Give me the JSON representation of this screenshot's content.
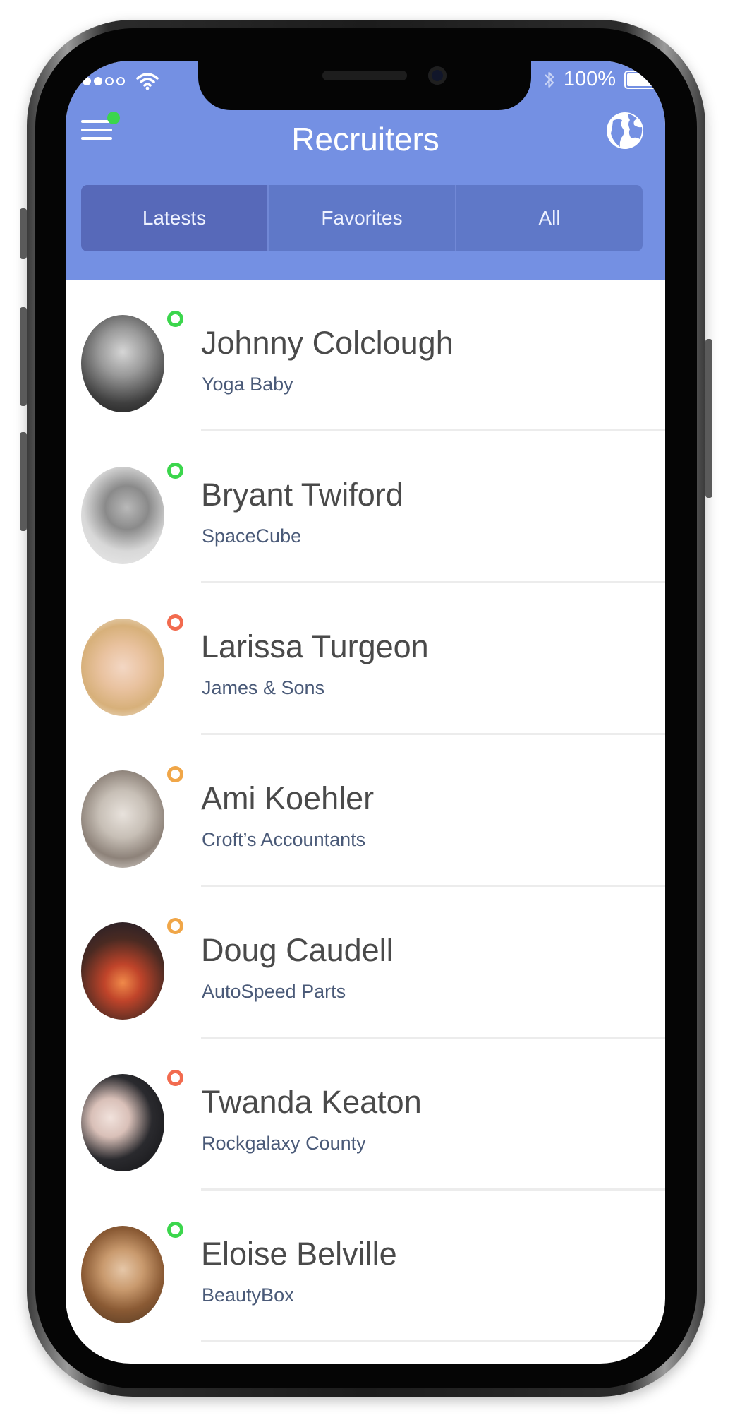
{
  "status_bar": {
    "battery": "100%"
  },
  "header": {
    "title": "Recruiters"
  },
  "tabs": [
    {
      "label": "Latests",
      "active": true
    },
    {
      "label": "Favorites",
      "active": false
    },
    {
      "label": "All",
      "active": false
    }
  ],
  "recruiters": [
    {
      "name": "Johnny Colclough",
      "company": "Yoga Baby",
      "status_color": "#3bd64c"
    },
    {
      "name": "Bryant Twiford",
      "company": "SpaceCube",
      "status_color": "#3bd64c"
    },
    {
      "name": "Larissa Turgeon",
      "company": "James & Sons",
      "status_color": "#f26b4f"
    },
    {
      "name": "Ami Koehler",
      "company": "Croft’s Accountants",
      "status_color": "#f0a648"
    },
    {
      "name": "Doug Caudell",
      "company": "AutoSpeed Parts",
      "status_color": "#f0a648"
    },
    {
      "name": "Twanda Keaton",
      "company": "Rockgalaxy County",
      "status_color": "#f26b4f"
    },
    {
      "name": "Eloise Belville",
      "company": "BeautyBox",
      "status_color": "#3bd64c"
    }
  ],
  "colors": {
    "header": "#7490e3",
    "tab_bar": "#5f78c8",
    "tab_active": "#5769b9",
    "online": "#3bd64c",
    "away": "#f0a648",
    "busy": "#f26b4f"
  }
}
